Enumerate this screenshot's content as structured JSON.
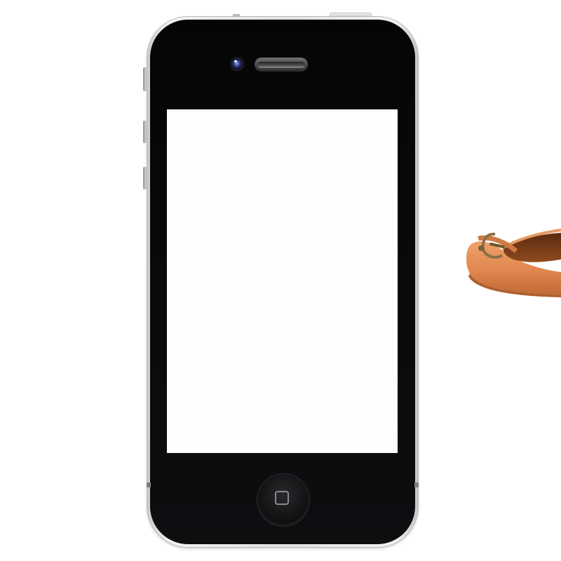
{
  "page": {
    "background": "#ffffff"
  },
  "phone": {
    "frame_color": "#e2e2e2",
    "body_color": "#0b0a0c",
    "screen_color": "#fcfefd",
    "icons": [
      "front-camera-icon",
      "earpiece-speaker-icon",
      "home-button-square-icon"
    ]
  },
  "shoe": {
    "type": "ballet flat",
    "leather_color": "#e0874f",
    "lining_color": "#7a3a16",
    "buckle_color": "#8a7048"
  }
}
